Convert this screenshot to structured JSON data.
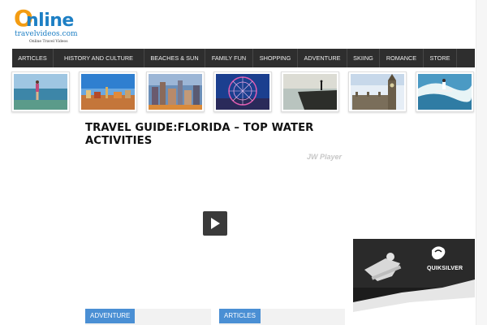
{
  "logo": {
    "main_first": "O",
    "main_rest": "nline",
    "site": "travelvideos.com",
    "tagline": "Online Travel Videos"
  },
  "nav": {
    "items": [
      "ARTICLES",
      "HISTORY AND CULTURE",
      "BEACHES & SUN",
      "FAMILY FUN",
      "SHOPPING",
      "ADVENTURE",
      "SKIING",
      "ROMANCE",
      "STORE"
    ]
  },
  "thumbnails": [
    "beach",
    "city-coast",
    "city-skyline",
    "ferris-wheel",
    "cliff-sunset",
    "big-ben",
    "surfer"
  ],
  "article": {
    "title": "TRAVEL GUIDE:FLORIDA – TOP WATER ACTIVITIES"
  },
  "player": {
    "watermark": "JW Player",
    "play_icon": "play-icon"
  },
  "ad": {
    "brand": "QUIKSILVER"
  },
  "categories": [
    "ADVENTURE",
    "ARTICLES"
  ],
  "colors": {
    "nav_bg": "#2e2e2e",
    "logo_orange": "#f39c12",
    "logo_blue": "#1d7fc4",
    "category_blue": "#4a8fd4"
  }
}
